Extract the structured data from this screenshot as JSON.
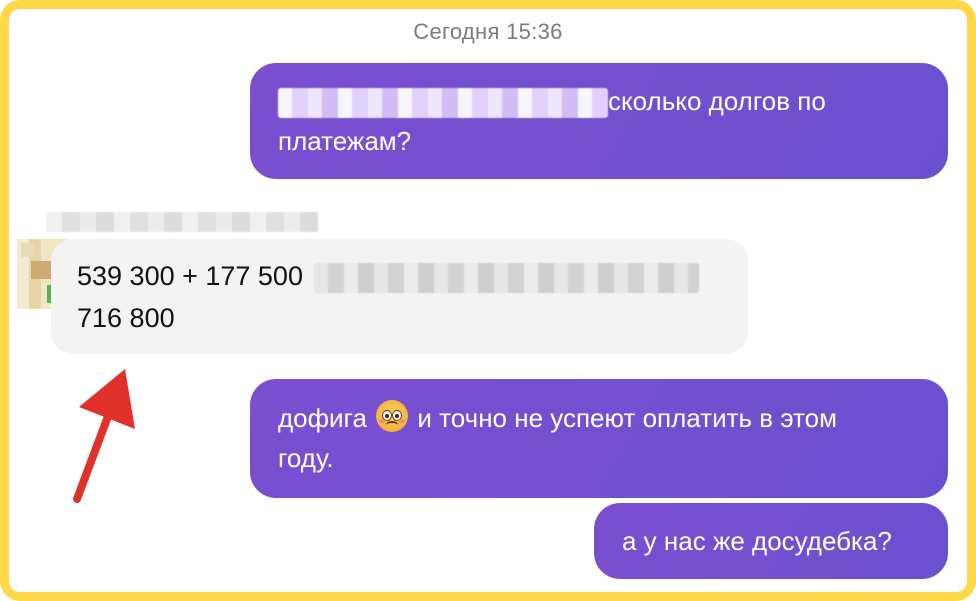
{
  "chat": {
    "timestamp": "Сегодня 15:36",
    "messages": [
      {
        "direction": "outgoing",
        "line1": "сколько долгов по",
        "line2": "платежам?"
      },
      {
        "direction": "incoming",
        "line1": "539 300 + 177 500",
        "line2": "716 800"
      },
      {
        "direction": "outgoing",
        "line1_a": "дофига",
        "line1_b": "и точно не успеют оплатить в этом",
        "line2": "году.",
        "emoji": "worried-face-emoji"
      },
      {
        "direction": "outgoing",
        "line1": "а у нас же досудебка?"
      }
    ]
  },
  "colors": {
    "frame": "#ffd84a",
    "outgoing_bubble": "#7050cf",
    "incoming_bubble": "#f3f3f3",
    "annotation_arrow": "#e0302a"
  }
}
